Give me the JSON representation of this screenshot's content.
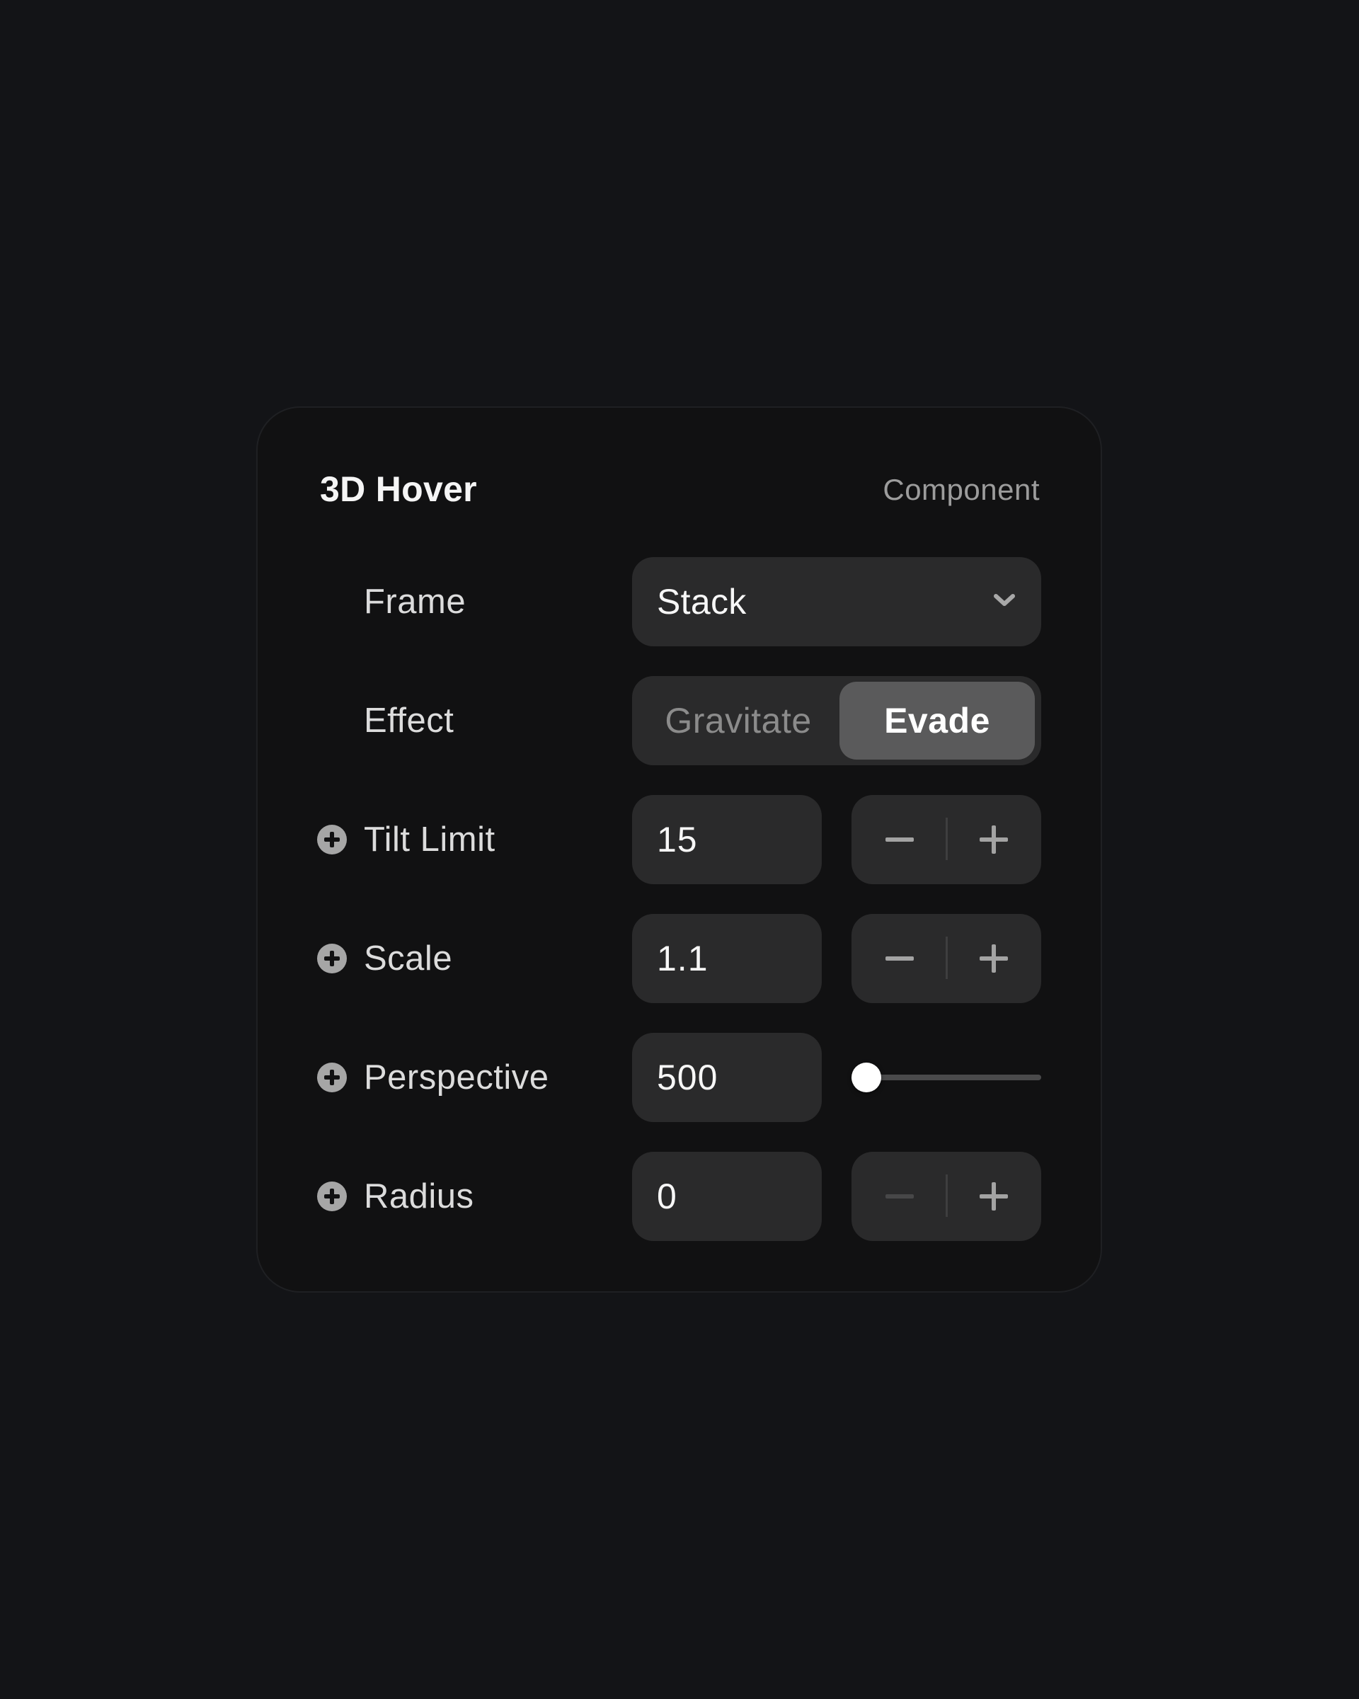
{
  "panel": {
    "title": "3D Hover",
    "subtitle": "Component"
  },
  "frame": {
    "label": "Frame",
    "value": "Stack",
    "icon": "chevron-down-icon"
  },
  "effect": {
    "label": "Effect",
    "options": [
      "Gravitate",
      "Evade"
    ],
    "selected": "Evade"
  },
  "tilt_limit": {
    "label": "Tilt Limit",
    "value": "15",
    "icon": "plus-circle-icon",
    "decrement_enabled": true,
    "increment_enabled": true
  },
  "scale": {
    "label": "Scale",
    "value": "1.1",
    "icon": "plus-circle-icon",
    "decrement_enabled": true,
    "increment_enabled": true
  },
  "perspective": {
    "label": "Perspective",
    "value": "500",
    "icon": "plus-circle-icon",
    "slider_fraction": 0.0
  },
  "radius": {
    "label": "Radius",
    "value": "0",
    "icon": "plus-circle-icon",
    "decrement_enabled": false,
    "increment_enabled": true
  },
  "colors": {
    "page_bg": "#131417",
    "card_bg": "#111112",
    "control_bg": "#2a2a2b",
    "selected_segment_bg": "#5a5a5b",
    "slider_knob": "#ffffff"
  }
}
